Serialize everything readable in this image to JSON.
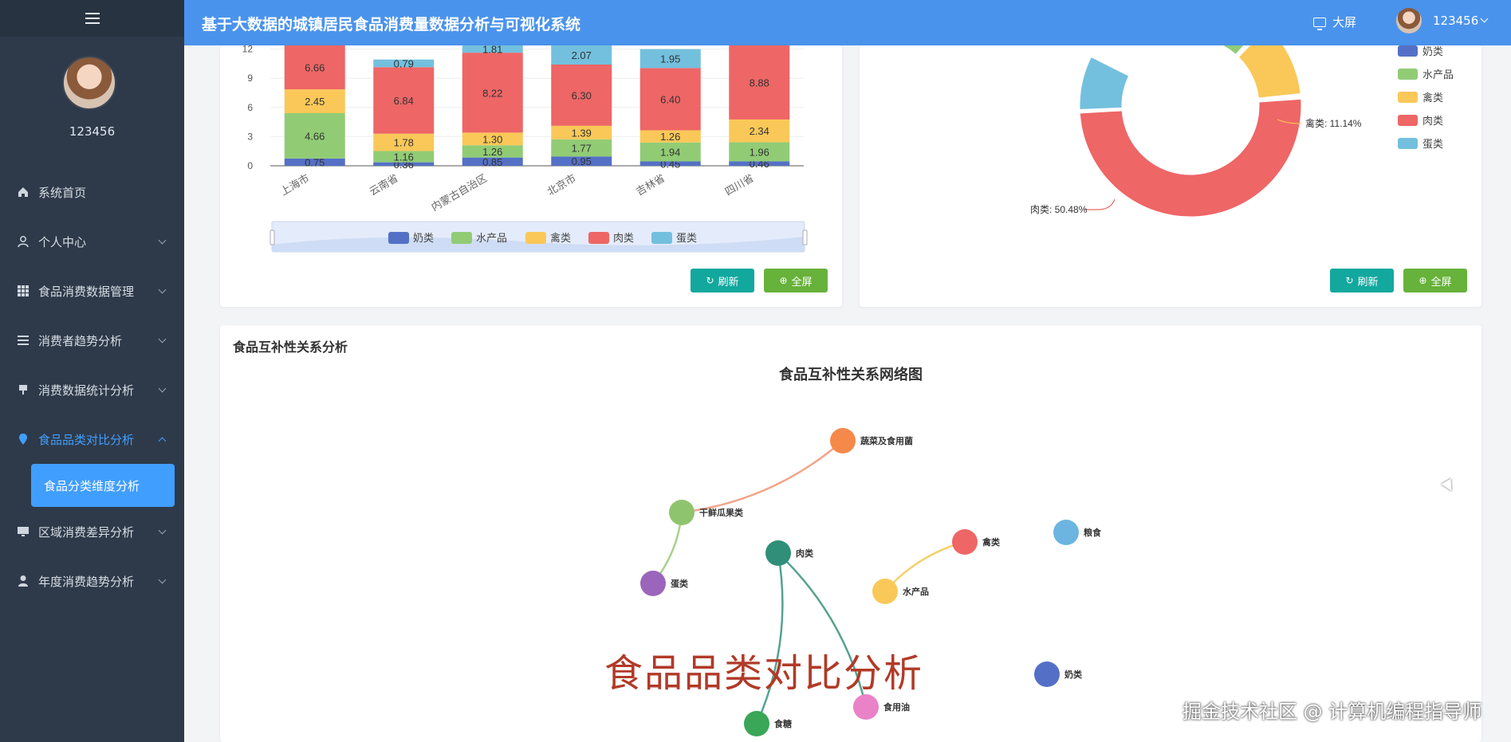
{
  "header": {
    "title": "基于大数据的城镇居民食品消费量数据分析与可视化系统",
    "bigscreen": "大屏",
    "user": "123456"
  },
  "sidebar": {
    "username": "123456",
    "items": [
      {
        "label": "系统首页",
        "icon": "home-icon"
      },
      {
        "label": "个人中心",
        "icon": "user-icon"
      },
      {
        "label": "食品消费数据管理",
        "icon": "grid-icon"
      },
      {
        "label": "消费者趋势分析",
        "icon": "list-icon"
      },
      {
        "label": "消费数据统计分析",
        "icon": "chart-icon"
      },
      {
        "label": "食品品类对比分析",
        "icon": "pin-icon"
      },
      {
        "label": "区域消费差异分析",
        "icon": "monitor-icon"
      },
      {
        "label": "年度消费趋势分析",
        "icon": "person-icon"
      }
    ],
    "sub_item": "食品分类维度分析"
  },
  "buttons": {
    "refresh": "刷新",
    "fullscreen": "全屏"
  },
  "colors": {
    "奶类": "#5470c6",
    "水产品": "#91cc75",
    "禽类": "#fac858",
    "肉类": "#ee6666",
    "蛋类": "#73c0de"
  },
  "chart_data": [
    {
      "type": "bar",
      "stacked": true,
      "categories": [
        "上海市",
        "云南省",
        "内蒙古自治区",
        "北京市",
        "吉林省",
        "四川省"
      ],
      "series": [
        {
          "name": "奶类",
          "values": [
            0.75,
            0.36,
            0.85,
            0.95,
            0.45,
            0.46
          ]
        },
        {
          "name": "水产品",
          "values": [
            4.66,
            1.16,
            1.26,
            1.77,
            1.94,
            1.96
          ]
        },
        {
          "name": "禽类",
          "values": [
            2.45,
            1.78,
            1.3,
            1.39,
            1.26,
            2.34
          ]
        },
        {
          "name": "肉类",
          "values": [
            6.66,
            6.84,
            8.22,
            6.3,
            6.4,
            8.88
          ]
        },
        {
          "name": "蛋类",
          "values": [
            null,
            0.79,
            1.81,
            2.07,
            1.95,
            null
          ]
        }
      ],
      "yticks": [
        "0",
        "3",
        "6",
        "9",
        "12"
      ],
      "ylim": [
        0,
        14
      ],
      "legend": [
        "奶类",
        "水产品",
        "禽类",
        "肉类",
        "蛋类"
      ]
    },
    {
      "type": "pie",
      "donut": true,
      "slices": [
        {
          "name": "肉类",
          "label": "肉类: 50.48%",
          "value": 50.48
        },
        {
          "name": "禽类",
          "label": "禽类: 11.14%",
          "value": 11.14
        }
      ],
      "legend": [
        "奶类",
        "水产品",
        "禽类",
        "肉类",
        "蛋类"
      ]
    },
    {
      "type": "graph",
      "title": "食品互补性关系网络图",
      "nodes": [
        {
          "name": "蔬菜及食用菌",
          "color": "#f5894a"
        },
        {
          "name": "干鲜瓜果类",
          "color": "#8fc46f"
        },
        {
          "name": "蛋类",
          "color": "#9b65bb"
        },
        {
          "name": "肉类",
          "color": "#2f8f78"
        },
        {
          "name": "禽类",
          "color": "#ee6666"
        },
        {
          "name": "水产品",
          "color": "#fac858"
        },
        {
          "name": "粮食",
          "color": "#6cb5e0"
        },
        {
          "name": "奶类",
          "color": "#5470c6"
        },
        {
          "name": "食用油",
          "color": "#ea82c8"
        },
        {
          "name": "食糖",
          "color": "#3aa657"
        }
      ],
      "edges": [
        [
          "蔬菜及食用菌",
          "干鲜瓜果类"
        ],
        [
          "干鲜瓜果类",
          "蛋类"
        ],
        [
          "水产品",
          "禽类"
        ],
        [
          "肉类",
          "食糖"
        ],
        [
          "肉类",
          "食用油"
        ]
      ]
    }
  ],
  "section": {
    "title": "食品互补性关系分析"
  },
  "overlay": {
    "watermark": "食品品类对比分析",
    "credit": "掘金技术社区 @ 计算机编程指导师"
  }
}
